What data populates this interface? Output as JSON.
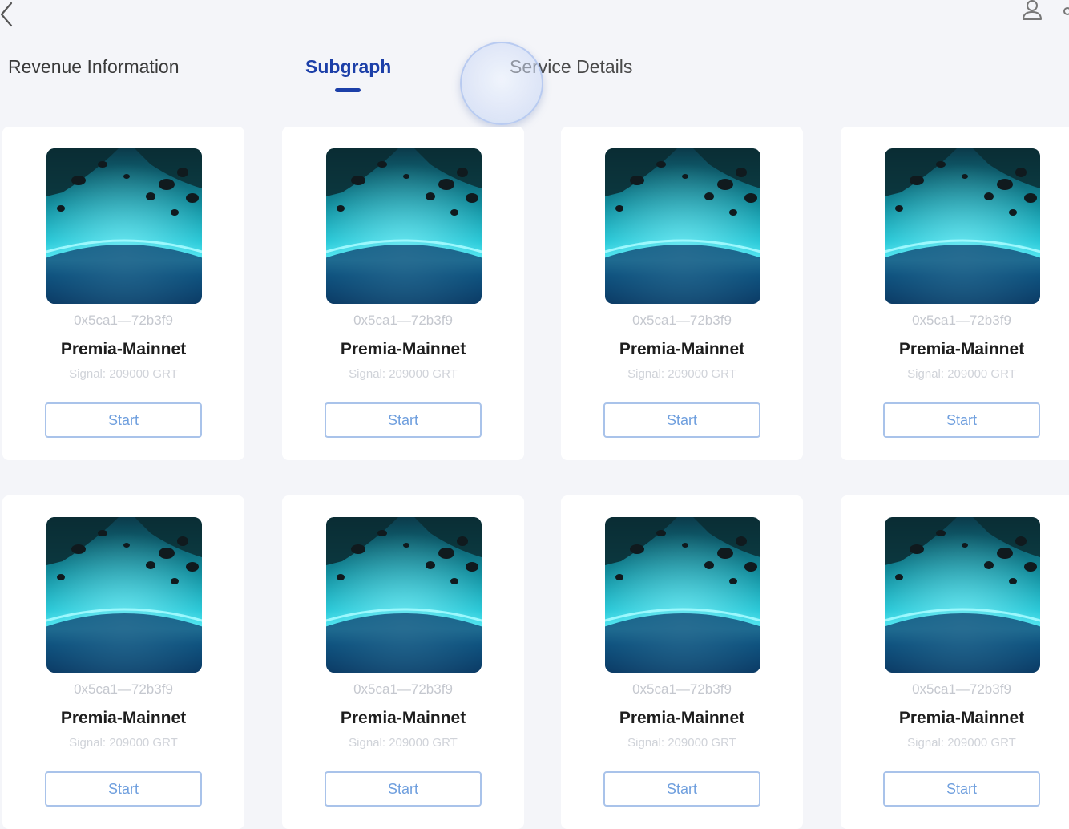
{
  "header": {
    "back_icon": "chevron-left-icon",
    "user_icon": "user-icon",
    "more_icon": "more-icon"
  },
  "tabs": [
    {
      "label": "Revenue Information",
      "active": false
    },
    {
      "label": "Subgraph",
      "active": true
    },
    {
      "label": "Service Details",
      "active": false
    }
  ],
  "colors": {
    "accent": "#1c3fa8",
    "button_text": "#6f9fde",
    "button_border": "#a9c3ea",
    "background": "#f4f5f9"
  },
  "cards": [
    {
      "hash": "0x5ca1—72b3f9",
      "name": "Premia-Mainnet",
      "signal": "Signal: 209000 GRT",
      "button": "Start"
    },
    {
      "hash": "0x5ca1—72b3f9",
      "name": "Premia-Mainnet",
      "signal": "Signal: 209000 GRT",
      "button": "Start"
    },
    {
      "hash": "0x5ca1—72b3f9",
      "name": "Premia-Mainnet",
      "signal": "Signal: 209000 GRT",
      "button": "Start"
    },
    {
      "hash": "0x5ca1—72b3f9",
      "name": "Premia-Mainnet",
      "signal": "Signal: 209000 GRT",
      "button": "Start"
    },
    {
      "hash": "0x5ca1—72b3f9",
      "name": "Premia-Mainnet",
      "signal": "Signal: 209000 GRT",
      "button": "Start"
    },
    {
      "hash": "0x5ca1—72b3f9",
      "name": "Premia-Mainnet",
      "signal": "Signal: 209000 GRT",
      "button": "Start"
    },
    {
      "hash": "0x5ca1—72b3f9",
      "name": "Premia-Mainnet",
      "signal": "Signal: 209000 GRT",
      "button": "Start"
    },
    {
      "hash": "0x5ca1—72b3f9",
      "name": "Premia-Mainnet",
      "signal": "Signal: 209000 GRT",
      "button": "Start"
    }
  ]
}
